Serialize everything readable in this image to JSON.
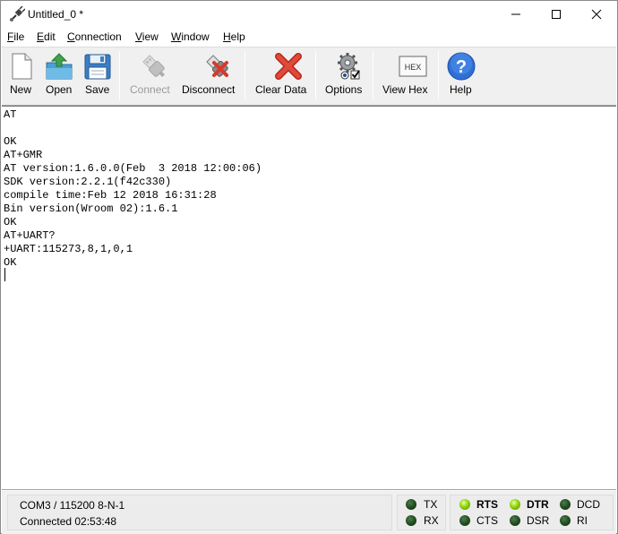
{
  "window": {
    "title": "Untitled_0 *"
  },
  "menu": {
    "items": [
      "File",
      "Edit",
      "Connection",
      "View",
      "Window",
      "Help"
    ],
    "underline": [
      "F",
      "E",
      "C",
      "V",
      "W",
      "H"
    ],
    "rest": [
      "ile",
      "dit",
      "onnection",
      "iew",
      "indow",
      "elp"
    ]
  },
  "toolbar": {
    "new_label": "New",
    "open_label": "Open",
    "save_label": "Save",
    "connect_label": "Connect",
    "disconnect_label": "Disconnect",
    "clear_label": "Clear Data",
    "options_label": "Options",
    "viewhex_label": "View Hex",
    "hex_icon_text": "HEX",
    "help_label": "Help"
  },
  "terminal": {
    "lines": [
      "AT",
      "",
      "OK",
      "AT+GMR",
      "AT version:1.6.0.0(Feb  3 2018 12:00:06)",
      "SDK version:2.2.1(f42c330)",
      "compile time:Feb 12 2018 16:31:28",
      "Bin version(Wroom 02):1.6.1",
      "OK",
      "AT+UART?",
      "+UART:115273,8,1,0,1",
      "OK"
    ]
  },
  "status": {
    "port": "COM3 / 115200 8-N-1",
    "connected": "Connected 02:53:48",
    "signals": {
      "tx": "TX",
      "rx": "RX",
      "rts": "RTS",
      "cts": "CTS",
      "dtr": "DTR",
      "dsr": "DSR",
      "dcd": "DCD",
      "ri": "RI"
    }
  },
  "colors": {
    "led_on": "#8fd400",
    "led_off": "#1e4a1e",
    "clear_x": "#d9382a",
    "help_circle": "#2f6fd6"
  }
}
